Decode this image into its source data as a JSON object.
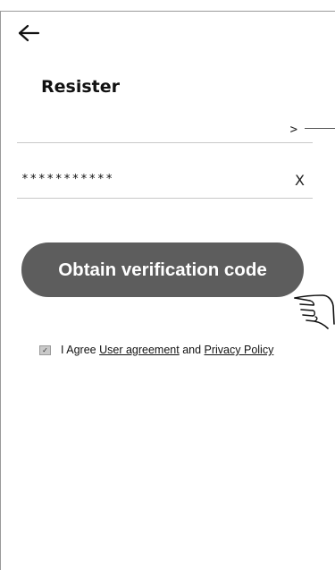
{
  "header": {
    "title": "Resister"
  },
  "form": {
    "region_chevron": ">",
    "password_value": "***********",
    "clear_label": "X"
  },
  "actions": {
    "obtain_code_label": "Obtain verification code"
  },
  "agreement": {
    "checked": true,
    "prefix": "I Agree ",
    "user_agreement": "User agreement",
    "middle": " and ",
    "privacy_policy": "Privacy Policy"
  },
  "icons": {
    "back": "arrow-left-icon",
    "pointer": "pointing-hand-icon",
    "check": "checkmark-icon"
  },
  "colors": {
    "button_bg": "#5d5d5d",
    "divider": "#c8c8c8"
  }
}
